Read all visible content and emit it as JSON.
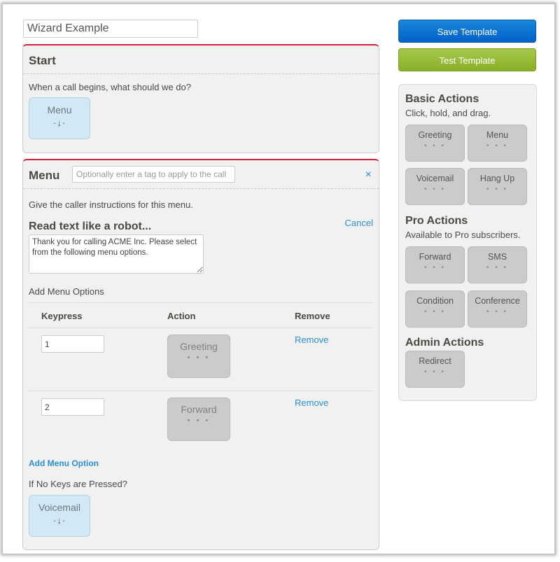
{
  "template_name": "Wizard Example",
  "toolbar": {
    "save_label": "Save Template",
    "test_label": "Test Template"
  },
  "colors": {
    "accent_red": "#d3213a",
    "save_blue": "#0a6fd0",
    "test_green": "#95bb30",
    "link_blue": "#2b8fd1",
    "drop_target_bg": "#d3e8f5",
    "tile_bg": "#cbcbcb"
  },
  "start_panel": {
    "title": "Start",
    "prompt": "When a call begins, what should we do?",
    "target": {
      "label": "Menu",
      "icon": "drop-arrow-icon",
      "glyph": "·↓·"
    }
  },
  "menu_panel": {
    "title": "Menu",
    "tag_placeholder": "Optionally enter a tag to apply to the call",
    "tag_value": "",
    "close_glyph": "×",
    "instructions": "Give the caller instructions for this menu.",
    "robot_heading": "Read text like a robot...",
    "cancel_label": "Cancel",
    "robot_text": "Thank you for calling ACME Inc. Please select from the following menu options.",
    "options_label": "Add Menu Options",
    "columns": [
      "Keypress",
      "Action",
      "Remove"
    ],
    "options": [
      {
        "keypress": "1",
        "action": "Greeting",
        "dots": "• • •",
        "remove_label": "Remove"
      },
      {
        "keypress": "2",
        "action": "Forward",
        "dots": "• • •",
        "remove_label": "Remove"
      }
    ],
    "add_option_label": "Add Menu Option",
    "no_keys_label": "If No Keys are Pressed?",
    "no_keys_target": {
      "label": "Voicemail",
      "icon": "drop-arrow-icon",
      "glyph": "·↓·"
    }
  },
  "sidebar": {
    "sections": [
      {
        "title": "Basic Actions",
        "subtitle": "Click, hold, and drag.",
        "items": [
          {
            "label": "Greeting",
            "dots": "• • •"
          },
          {
            "label": "Menu",
            "dots": "• • •"
          },
          {
            "label": "Voicemail",
            "dots": "• • •"
          },
          {
            "label": "Hang Up",
            "dots": "• • •"
          }
        ]
      },
      {
        "title": "Pro Actions",
        "subtitle": "Available to Pro subscribers.",
        "items": [
          {
            "label": "Forward",
            "dots": "• • •"
          },
          {
            "label": "SMS",
            "dots": "• • •"
          },
          {
            "label": "Condition",
            "dots": "• • •"
          },
          {
            "label": "Conference",
            "dots": "• • •"
          }
        ]
      },
      {
        "title": "Admin Actions",
        "subtitle": "",
        "items": [
          {
            "label": "Redirect",
            "dots": "• • •"
          }
        ]
      }
    ]
  }
}
